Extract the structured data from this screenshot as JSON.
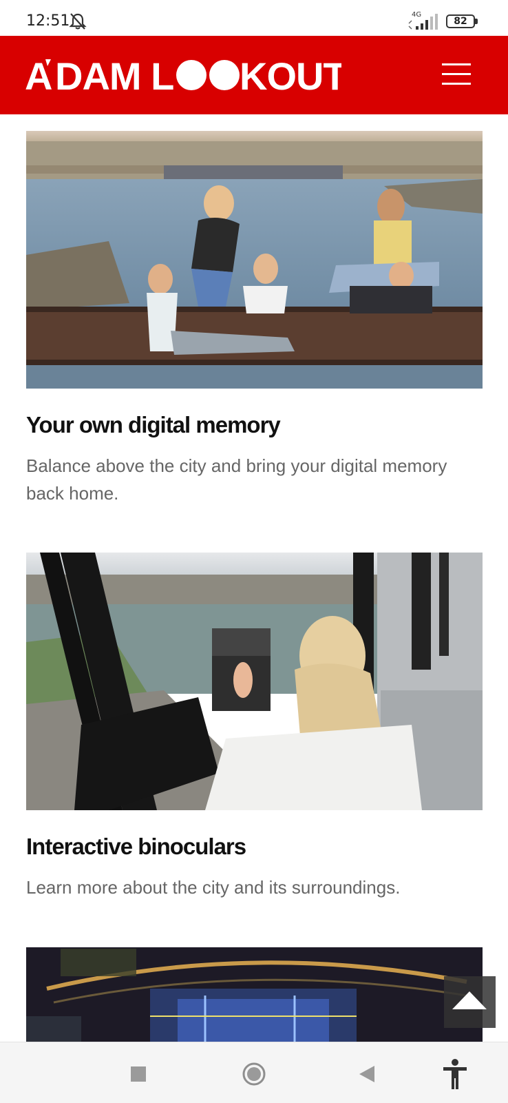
{
  "status_bar": {
    "time": "12:51",
    "network": "4G",
    "battery": "82",
    "icons": [
      "bell-off-icon",
      "signal-icon",
      "battery-icon"
    ]
  },
  "header": {
    "logo_text": "A'DAM LOOKOUT",
    "brand_color": "#d80000",
    "menu_icon": "hamburger-icon"
  },
  "cards": [
    {
      "title": "Your own digital memory",
      "description": "Balance above the city and bring your digital memory back home.",
      "image": "group-on-beam-over-amsterdam-photo"
    },
    {
      "title": "Interactive binoculars",
      "description": "Learn more about the city and its surroundings.",
      "image": "woman-using-binoculars-photo"
    },
    {
      "image": "elevator-interior-photo"
    }
  ],
  "back_to_top_icon": "arrow-up-icon",
  "nav_bar": {
    "icons": [
      "recent-apps-icon",
      "home-icon",
      "back-icon",
      "accessibility-icon"
    ]
  }
}
